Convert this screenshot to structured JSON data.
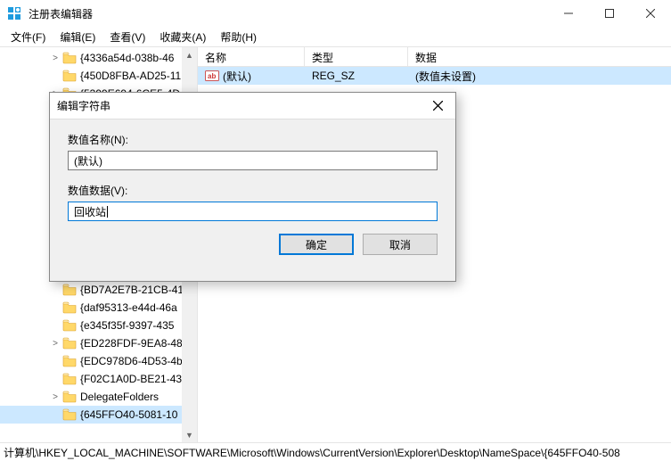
{
  "window": {
    "title": "注册表编辑器"
  },
  "menu": {
    "file": "文件(F)",
    "edit": "编辑(E)",
    "view": "查看(V)",
    "favorites": "收藏夹(A)",
    "help": "帮助(H)"
  },
  "tree": {
    "items": [
      {
        "label": "{4336a54d-038b-46",
        "toggle": ">"
      },
      {
        "label": "{450D8FBA-AD25-11",
        "toggle": ""
      },
      {
        "label": "{5399E694-6CE5-4D",
        "toggle": ">"
      },
      {
        "label": "",
        "toggle": ""
      },
      {
        "label": "",
        "toggle": ""
      },
      {
        "label": "",
        "toggle": ""
      },
      {
        "label": "",
        "toggle": ""
      },
      {
        "label": "",
        "toggle": ""
      },
      {
        "label": "",
        "toggle": ""
      },
      {
        "label": "",
        "toggle": ""
      },
      {
        "label": "",
        "toggle": ""
      },
      {
        "label": "",
        "toggle": ""
      },
      {
        "label": "",
        "toggle": ""
      },
      {
        "label": "{BD7A2E7B-21CB-41",
        "toggle": ""
      },
      {
        "label": "{daf95313-e44d-46a",
        "toggle": ""
      },
      {
        "label": "{e345f35f-9397-435",
        "toggle": ""
      },
      {
        "label": "{ED228FDF-9EA8-48",
        "toggle": ">"
      },
      {
        "label": "{EDC978D6-4D53-4b",
        "toggle": ""
      },
      {
        "label": "{F02C1A0D-BE21-43",
        "toggle": ""
      },
      {
        "label": "DelegateFolders",
        "toggle": ">"
      },
      {
        "label": "{645FFO40-5081-10",
        "toggle": "",
        "sel": true
      }
    ]
  },
  "list": {
    "headers": {
      "name": "名称",
      "type": "类型",
      "data": "数据"
    },
    "row": {
      "name": "(默认)",
      "type": "REG_SZ",
      "data": "(数值未设置)"
    }
  },
  "dialog": {
    "title": "编辑字符串",
    "name_label": "数值名称(N):",
    "name_value": "(默认)",
    "data_label": "数值数据(V):",
    "data_value": "回收站",
    "ok": "确定",
    "cancel": "取消"
  },
  "statusbar": {
    "path": "计算机\\HKEY_LOCAL_MACHINE\\SOFTWARE\\Microsoft\\Windows\\CurrentVersion\\Explorer\\Desktop\\NameSpace\\{645FFO40-508"
  }
}
